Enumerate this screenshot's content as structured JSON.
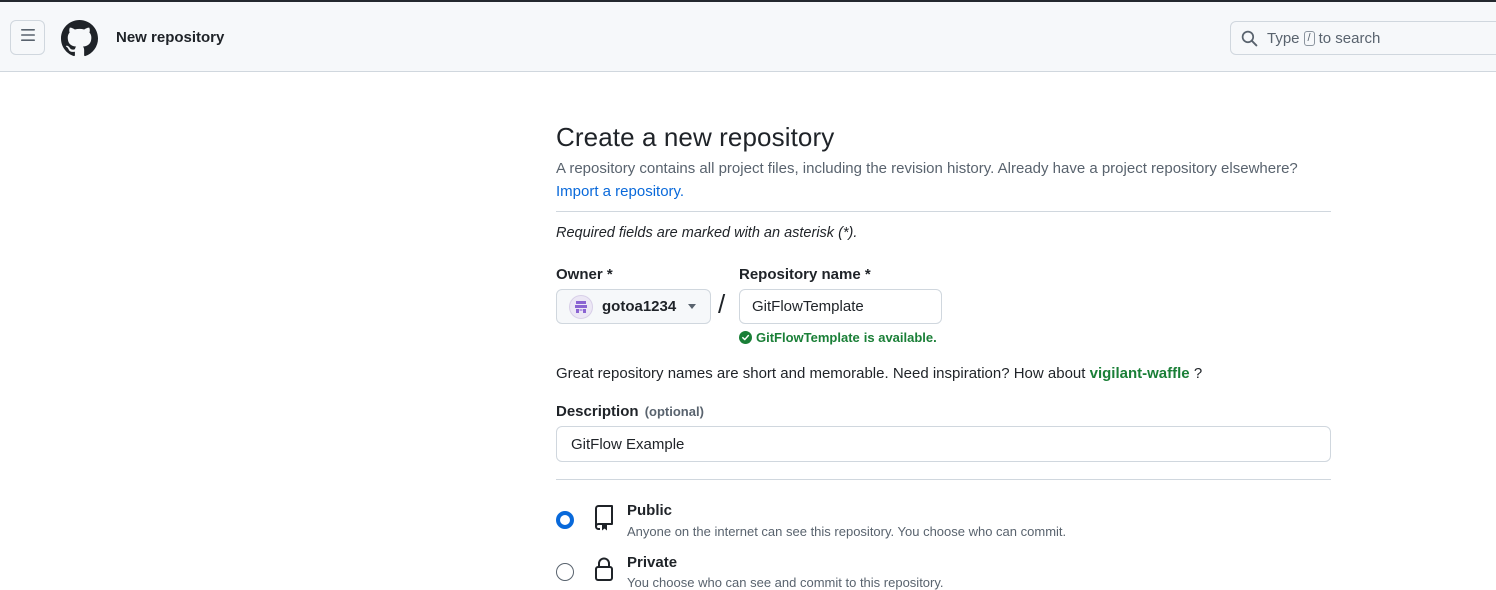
{
  "header": {
    "menu_icon": "hamburger-icon",
    "logo_icon": "github-octocat-icon",
    "title": "New repository",
    "search": {
      "prefix": "Type",
      "key": "/",
      "suffix": "to search"
    }
  },
  "page": {
    "title": "Create a new repository",
    "subtitle": "A repository contains all project files, including the revision history. Already have a project repository elsewhere?",
    "import_link": "Import a repository.",
    "required_note": "Required fields are marked with an asterisk (*)."
  },
  "owner": {
    "label": "Owner *",
    "value": "gotoa1234"
  },
  "slash": "/",
  "repo_name": {
    "label": "Repository name *",
    "value": "GitFlowTemplate",
    "availability_name": "GitFlowTemplate",
    "availability_text": "is available."
  },
  "inspiration": {
    "text": "Great repository names are short and memorable. Need inspiration? How about",
    "suggestion": "vigilant-waffle",
    "question": "?"
  },
  "description": {
    "label": "Description",
    "optional": "(optional)",
    "value": "GitFlow Example"
  },
  "visibility": {
    "selected": "public",
    "options": [
      {
        "key": "public",
        "title": "Public",
        "desc": "Anyone on the internet can see this repository. You choose who can commit.",
        "icon": "repo-icon"
      },
      {
        "key": "private",
        "title": "Private",
        "desc": "You choose who can see and commit to this repository.",
        "icon": "lock-icon"
      }
    ]
  },
  "colors": {
    "accent": "#0969da",
    "success": "#1a7f37",
    "header_bg": "#f6f8fa",
    "border": "#d0d7de"
  }
}
